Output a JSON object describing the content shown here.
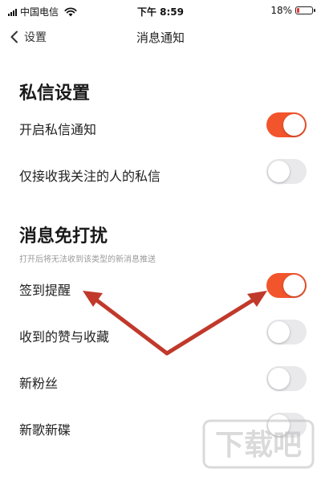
{
  "status_bar": {
    "carrier": "中国电信",
    "time": "下午 8:59",
    "battery_text": "18%",
    "battery_level": 0.18,
    "battery_color": "#e53935"
  },
  "nav": {
    "back_label": "设置",
    "title": "消息通知"
  },
  "sections": [
    {
      "title": "私信设置",
      "items": [
        {
          "label": "开启私信通知",
          "on": true
        },
        {
          "label": "仅接收我关注的人的私信",
          "on": false
        }
      ]
    },
    {
      "title": "消息免打扰",
      "hint": "打开后将无法收到该类型的新消息推送",
      "items": [
        {
          "label": "签到提醒",
          "on": true
        },
        {
          "label": "收到的赞与收藏",
          "on": false
        },
        {
          "label": "新粉丝",
          "on": false
        },
        {
          "label": "新歌新碟",
          "on": false
        }
      ]
    }
  ],
  "colors": {
    "toggle_on": "#f2552c",
    "toggle_off": "#e9e9ec",
    "annotation_arrow": "#c0392b"
  },
  "icons": [
    "signal-icon",
    "wifi-icon",
    "battery-icon",
    "chevron-left-icon"
  ],
  "watermark_text": "下载吧"
}
